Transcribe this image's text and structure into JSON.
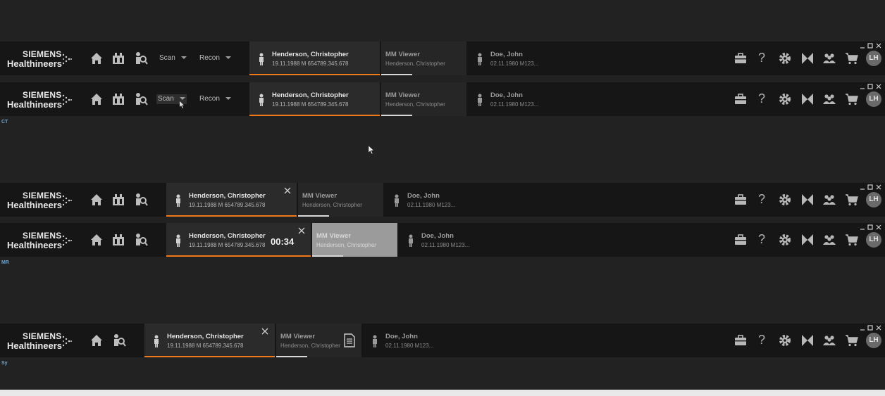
{
  "brand": {
    "line1": "SIEMENS",
    "line2": "Healthineers"
  },
  "menus": {
    "scan": "Scan",
    "recon": "Recon"
  },
  "patient_active": {
    "name": "Henderson, Christopher",
    "details": "19.11.1988 M 654789.345.678"
  },
  "viewer_tab": {
    "title": "MM Viewer",
    "patient": "Henderson, Christopher"
  },
  "patient_other": {
    "name": "Doe, John",
    "details": "02.11.1980 M123..."
  },
  "timer": "00:34",
  "user_initials": "LH",
  "help_glyph": "?",
  "mode_labels": {
    "ct": "CT",
    "mr": "MR",
    "sy": "Sy"
  },
  "colors": {
    "accent": "#f07a1a",
    "bar_bg": "#161616",
    "page_bg": "#222222",
    "mode_label": "#6aa6d6"
  },
  "icons": [
    "home-icon",
    "patient-browser-icon",
    "search-person-icon",
    "person-icon",
    "close-icon",
    "document-icon",
    "briefcase-icon",
    "help-icon",
    "gear-icon",
    "layout-icon",
    "users-icon",
    "cart-icon",
    "minimize-icon",
    "maximize-icon",
    "window-close-icon"
  ]
}
